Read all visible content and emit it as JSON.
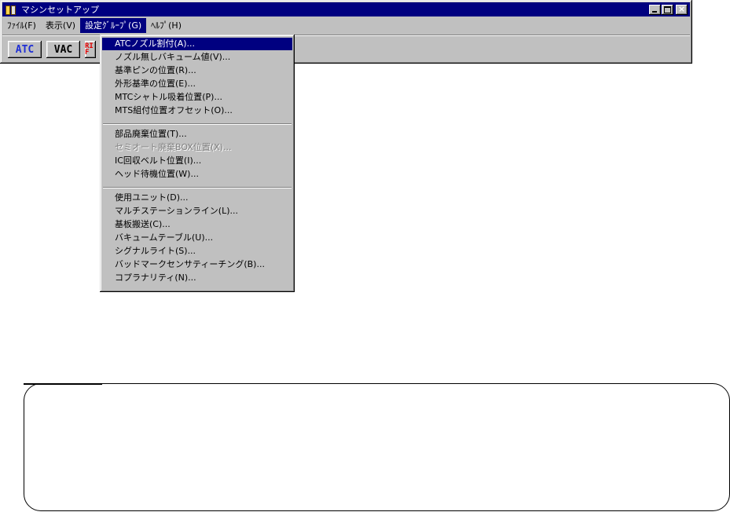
{
  "window": {
    "title": "マシンセットアップ",
    "icon": "machine-setup-icon",
    "controls": {
      "minimize": "minimize-icon",
      "maximize": "maximize-icon",
      "close_glyph": "×"
    }
  },
  "menubar": {
    "items": [
      {
        "label": "ﾌｧｲﾙ(F)"
      },
      {
        "label": "表示(V)"
      },
      {
        "label": "設定ｸﾞﾙｰﾌﾟ(G)"
      },
      {
        "label": "ﾍﾙﾌﾟ(H)"
      }
    ],
    "active_index": 2
  },
  "toolbar": {
    "atc_label": "ATC",
    "vac_label": "VAC",
    "third_label": "RI F"
  },
  "dropdown": {
    "items": [
      {
        "label": "ATCノズル割付(A)...",
        "state": "highlighted"
      },
      {
        "label": "ノズル無しバキューム値(V)..."
      },
      {
        "label": "基準ピンの位置(R)..."
      },
      {
        "label": "外形基準の位置(E)..."
      },
      {
        "label": "MTCシャトル吸着位置(P)..."
      },
      {
        "label": "MTS組付位置オフセット(O)..."
      },
      {
        "label": "部品廃棄位置(T)..."
      },
      {
        "label": "セミオート廃棄BOX位置(X)...",
        "state": "disabled"
      },
      {
        "label": "IC回収ベルト位置(I)..."
      },
      {
        "label": "ヘッド待機位置(W)..."
      },
      {
        "label": "使用ユニット(D)..."
      },
      {
        "label": "マルチステーションライン(L)..."
      },
      {
        "label": "基板搬送(C)..."
      },
      {
        "label": "バキュームテーブル(U)..."
      },
      {
        "label": "シグナルライト(S)..."
      },
      {
        "label": "バッドマークセンサティーチング(B)..."
      },
      {
        "label": "コプラナリティ(N)..."
      }
    ]
  },
  "colors": {
    "titlebar": "#000080",
    "highlight": "#000080",
    "face": "#c0c0c0",
    "atc_text": "#1f2fd6",
    "third_text": "#e00000"
  }
}
